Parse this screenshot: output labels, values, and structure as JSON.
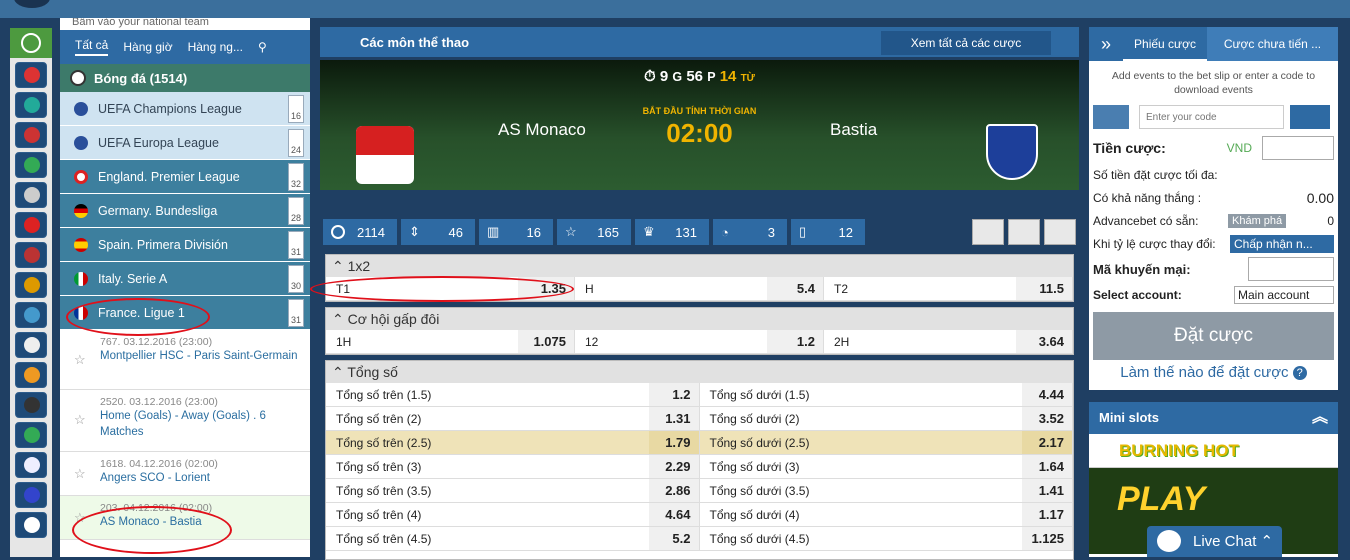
{
  "left_tabs": [
    "Tất cả",
    "Hàng giờ",
    "Hàng ng..."
  ],
  "left_top_text": "Bấm vào your national team",
  "sport": "Bóng đá (1514)",
  "leagues": [
    {
      "name": "UEFA Champions League",
      "count": "16"
    },
    {
      "name": "UEFA Europa League",
      "count": "24"
    },
    {
      "name": "England. Premier League",
      "count": "32"
    },
    {
      "name": "Germany. Bundesliga",
      "count": "28"
    },
    {
      "name": "Spain. Primera División",
      "count": "31"
    },
    {
      "name": "Italy. Serie A",
      "count": "30"
    },
    {
      "name": "France. Ligue 1",
      "count": "31"
    }
  ],
  "matches": [
    {
      "time": "767. 03.12.2016 (23:00)",
      "name": "Montpellier HSC - Paris Saint-Germain"
    },
    {
      "time": "2520. 03.12.2016 (23:00)",
      "name": "Home (Goals) - Away (Goals) . 6 Matches"
    },
    {
      "time": "1618. 04.12.2016 (02:00)",
      "name": "Angers SCO - Lorient"
    },
    {
      "time": "203. 04.12.2016 (02:00)",
      "name": "AS Monaco - Bastia"
    }
  ],
  "center": {
    "title": "Các môn thể thao",
    "see_all": "Xem tất cả các cược"
  },
  "hero": {
    "timer_prefix": "⏱ 9",
    "g": "G",
    "m": "56",
    "p": "P",
    "s": "14",
    "tu": "TỪ",
    "label": "BẮT ĐẦU TÍNH THỜI GIAN",
    "time": "02:00",
    "home": "AS Monaco",
    "away": "Bastia"
  },
  "stats": [
    "2114",
    "46",
    "16",
    "165",
    "131",
    "3",
    "12"
  ],
  "x12": {
    "title": "1x2",
    "cells": [
      [
        "T1",
        "1.35"
      ],
      [
        "H",
        "5.4"
      ],
      [
        "T2",
        "11.5"
      ]
    ]
  },
  "dbl": {
    "title": "Cơ hội gấp đôi",
    "cells": [
      [
        "1H",
        "1.075"
      ],
      [
        "12",
        "1.2"
      ],
      [
        "2H",
        "3.64"
      ]
    ]
  },
  "totals": {
    "title": "Tổng số",
    "rows": [
      [
        "Tổng số trên (1.5)",
        "1.2",
        "Tổng số dưới (1.5)",
        "4.44"
      ],
      [
        "Tổng số trên (2)",
        "1.31",
        "Tổng số dưới (2)",
        "3.52"
      ],
      [
        "Tổng số trên (2.5)",
        "1.79",
        "Tổng số dưới (2.5)",
        "2.17"
      ],
      [
        "Tổng số trên (3)",
        "2.29",
        "Tổng số dưới (3)",
        "1.64"
      ],
      [
        "Tổng số trên (3.5)",
        "2.86",
        "Tổng số dưới (3.5)",
        "1.41"
      ],
      [
        "Tổng số trên (4)",
        "4.64",
        "Tổng số dưới (4)",
        "1.17"
      ],
      [
        "Tổng số trên (4.5)",
        "5.2",
        "Tổng số dưới (4.5)",
        "1.125"
      ]
    ]
  },
  "right": {
    "tab1": "Phiếu cược",
    "tab2": "Cược chưa tiến ...",
    "info": "Add events to the bet slip or enter a code to download events",
    "code_placeholder": "Enter your code",
    "stake": "Tiền cược:",
    "currency": "VND",
    "max": "Số tiền đặt cược tối đa:",
    "win": "Có khả năng thắng :",
    "win_val": "0.00",
    "adv": "Advancebet có sẵn:",
    "explore": "Khám phá",
    "adv_val": "0",
    "odds_change": "Khi tỷ lệ cược thay đổi:",
    "accept": "Chấp nhận n...",
    "promo": "Mã khuyến mại:",
    "account": "Select account:",
    "main_account": "Main account",
    "place_bet": "Đặt cược",
    "how": "Làm thế nào để đặt cược"
  },
  "mini": {
    "title": "Mini slots",
    "game": "BURNING HOT",
    "promo": "PLAY"
  },
  "chat": "Live Chat"
}
